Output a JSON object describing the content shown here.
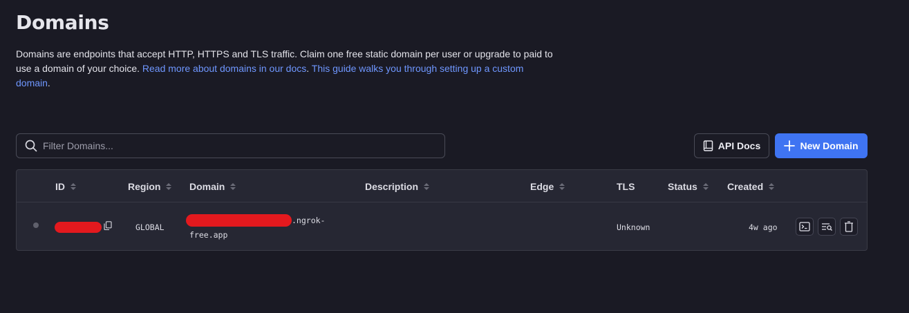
{
  "page": {
    "title": "Domains",
    "description_text": "Domains are endpoints that accept HTTP, HTTPS and TLS traffic. Claim one free static domain per user or upgrade to paid to use a domain of your choice. ",
    "docs_link": "Read more about domains in our docs",
    "period": ".",
    "guide_link": "This guide walks you through setting up a custom domain",
    "period2": "."
  },
  "toolbar": {
    "search_placeholder": "Filter Domains...",
    "api_docs_label": "API Docs",
    "new_domain_label": "New Domain"
  },
  "table": {
    "columns": [
      "ID",
      "Region",
      "Domain",
      "Description",
      "Edge",
      "TLS",
      "Status",
      "Created"
    ],
    "rows": [
      {
        "region": "GLOBAL",
        "domain_suffix": ".ngrok-",
        "domain_line2": "free.app",
        "description": "",
        "edge": "",
        "tls": "Unknown",
        "status": "",
        "created": "4w ago"
      }
    ]
  },
  "icons": [
    "search-icon",
    "book-icon",
    "plus-icon",
    "copy-icon",
    "terminal-icon",
    "log-search-icon",
    "trash-icon"
  ],
  "colors": {
    "background": "#1a1a24",
    "table_bg": "#262733",
    "accent": "#3f74f2",
    "link": "#6f97ff",
    "redaction": "#e3191e"
  }
}
